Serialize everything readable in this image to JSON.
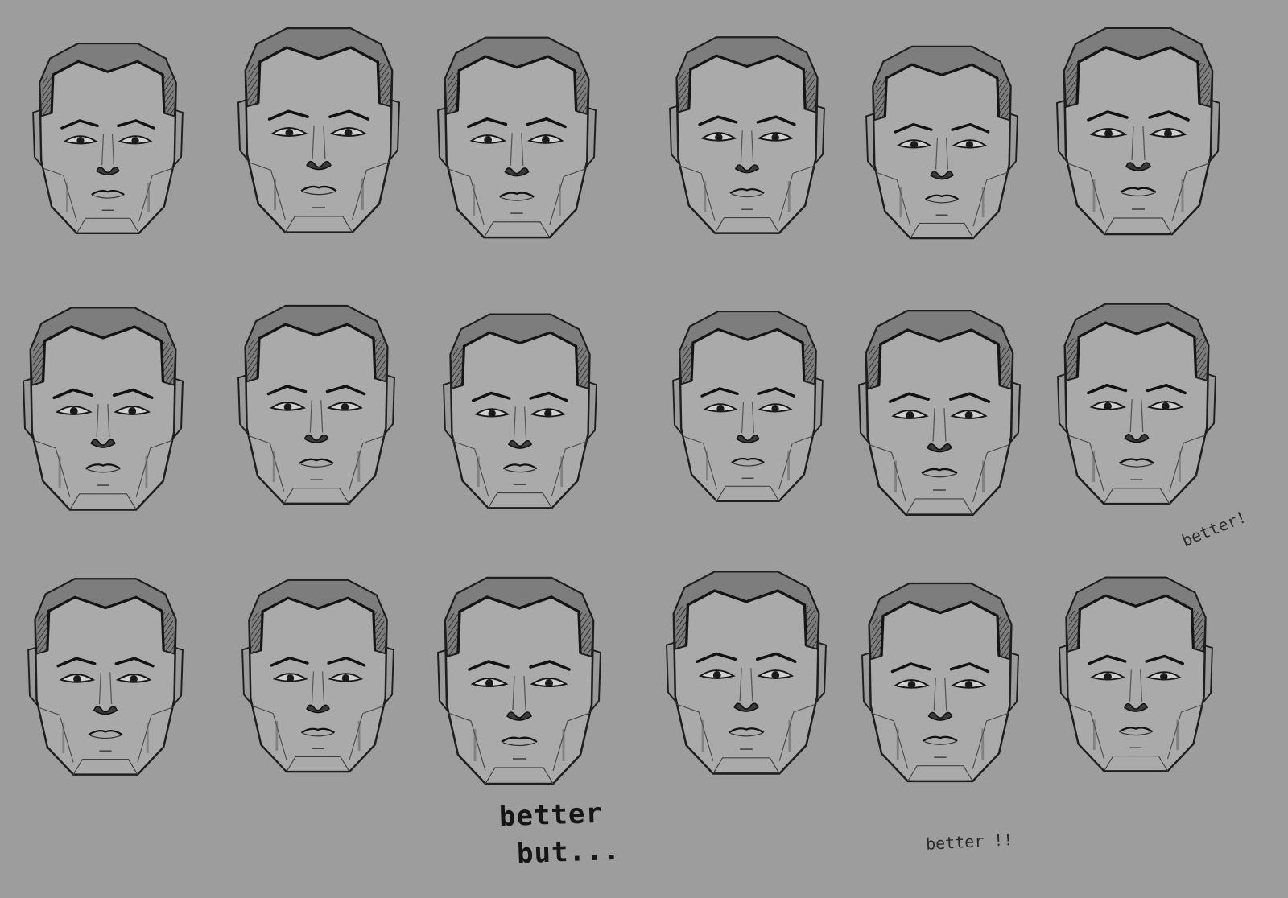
{
  "sheet": {
    "background_color": "#9d9d9d",
    "ink_color": "#1e1e1e",
    "skin_color": "#a9a9a9",
    "rows": 3,
    "columns": 6,
    "faces": [
      {
        "row": 1,
        "col": 1
      },
      {
        "row": 1,
        "col": 2
      },
      {
        "row": 1,
        "col": 3
      },
      {
        "row": 1,
        "col": 4
      },
      {
        "row": 1,
        "col": 5
      },
      {
        "row": 1,
        "col": 6
      },
      {
        "row": 2,
        "col": 1
      },
      {
        "row": 2,
        "col": 2
      },
      {
        "row": 2,
        "col": 3
      },
      {
        "row": 2,
        "col": 4
      },
      {
        "row": 2,
        "col": 5
      },
      {
        "row": 2,
        "col": 6
      },
      {
        "row": 3,
        "col": 1
      },
      {
        "row": 3,
        "col": 2
      },
      {
        "row": 3,
        "col": 3
      },
      {
        "row": 3,
        "col": 4
      },
      {
        "row": 3,
        "col": 5
      },
      {
        "row": 3,
        "col": 6
      }
    ]
  },
  "notes": {
    "row2_col6": "better!",
    "row3_col3_line1": "better",
    "row3_col3_line2": "but...",
    "row3_col5": "better !!"
  }
}
